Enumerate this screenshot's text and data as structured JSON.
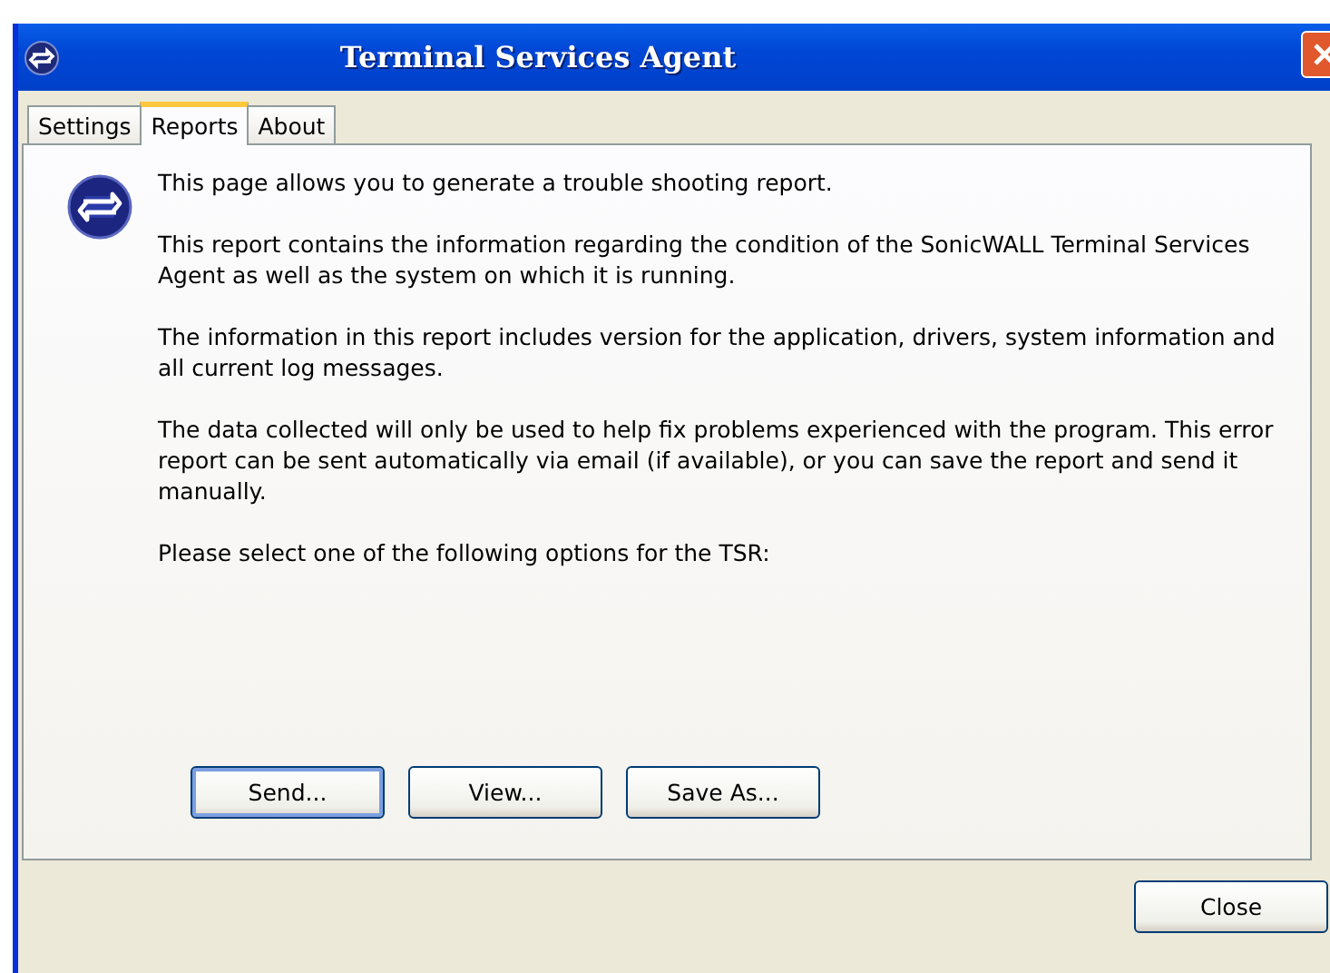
{
  "window": {
    "title": "Terminal Services Agent"
  },
  "tabs": [
    {
      "label": "Settings",
      "selected": false
    },
    {
      "label": "Reports",
      "selected": true
    },
    {
      "label": "About",
      "selected": false
    }
  ],
  "paragraphs": [
    "This page allows you to generate a trouble shooting report.",
    "This report contains the information regarding the condition of the SonicWALL Terminal Services Agent as well as the system on which it is running.",
    "The information in this report includes version for the application, drivers, system information and all current log messages.",
    "The data collected will only be used to help fix problems experienced with the program. This error report can be sent automatically via email (if available), or you can save the report and send it manually.",
    "Please select one of the following options for the TSR:"
  ],
  "actions": [
    {
      "label": "Send...",
      "default": true
    },
    {
      "label": "View...",
      "default": false
    },
    {
      "label": "Save As...",
      "default": false
    }
  ],
  "close_button": "Close"
}
